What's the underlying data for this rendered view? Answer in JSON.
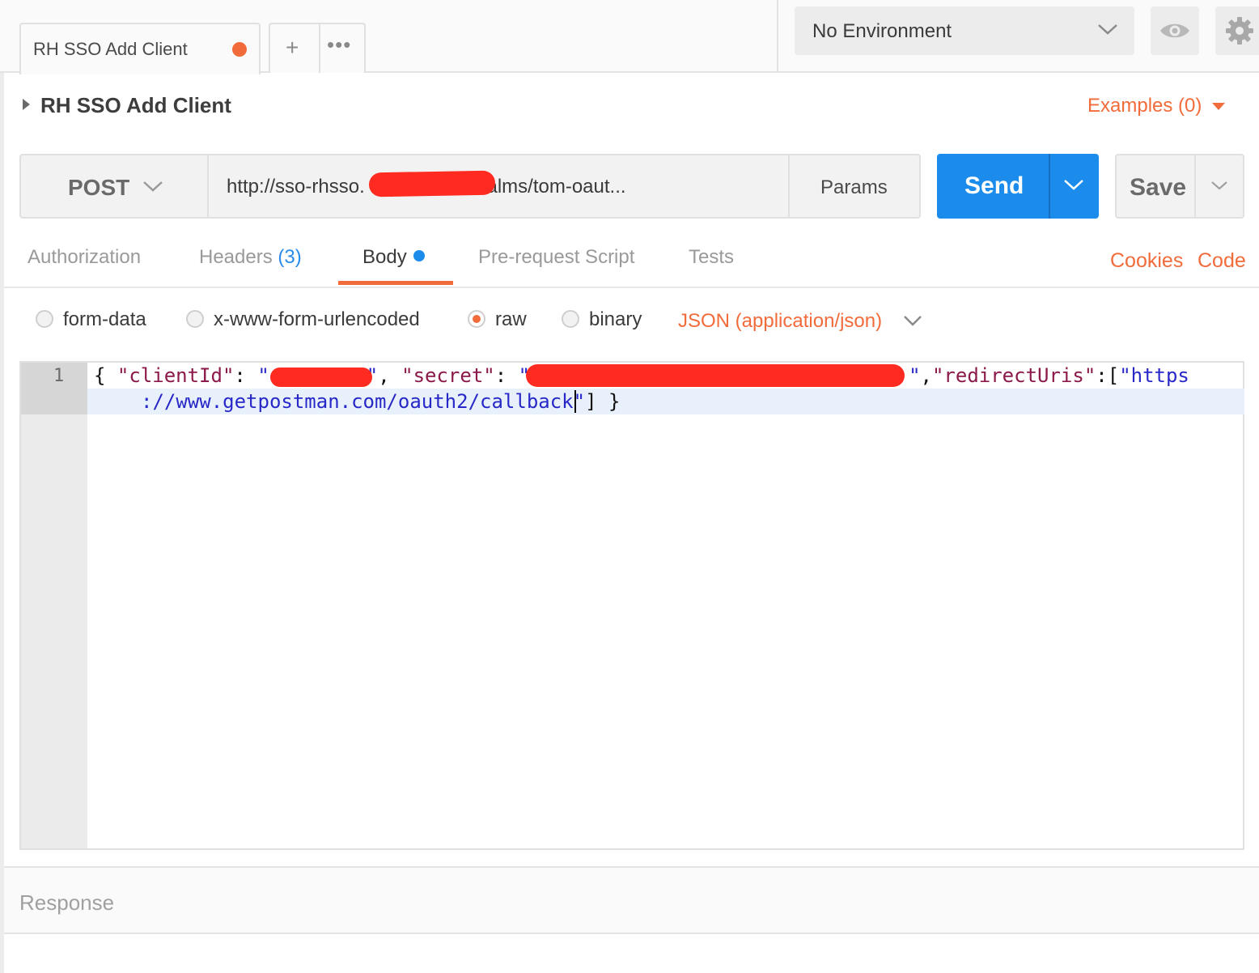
{
  "tabs": {
    "active_label": "RH SSO Add Client",
    "dot_color": "#f26b3a",
    "add_glyph": "+",
    "more_glyph": "•••"
  },
  "environment": {
    "selected": "No Environment",
    "quicklook_icon": "eye-icon",
    "settings_icon": "gear-icon"
  },
  "request": {
    "name": "RH SSO Add Client",
    "examples_label": "Examples (0)",
    "method": "POST",
    "url_visible": "http://sso-rhsso.                        .xip.io/auth/realms/tom-oaut...",
    "params_label": "Params",
    "send_label": "Send",
    "save_label": "Save"
  },
  "subtabs": {
    "authorization": "Authorization",
    "headers": "Headers",
    "headers_count": "(3)",
    "body": "Body",
    "prerequest": "Pre-request Script",
    "tests": "Tests",
    "cookies": "Cookies",
    "code": "Code"
  },
  "body_mode": {
    "form_data": "form-data",
    "urlencoded": "x-www-form-urlencoded",
    "raw": "raw",
    "binary": "binary",
    "selected": "raw",
    "content_type": "JSON (application/json)"
  },
  "editor": {
    "line_number": "1",
    "line1_open": "{ ",
    "key_client": "\"clientId\"",
    "colon1": ": ",
    "quote_a": "\"",
    "quote_b": "\"",
    "comma1": ", ",
    "key_secret": "\"secret\"",
    "colon2": ": ",
    "quote_c": "\"",
    "quote_d": "\"",
    "comma2": ",",
    "key_redirect": "\"redirectUris\"",
    "colon3": ":[",
    "url_part1": "\"https",
    "url_part2": "://www.getpostman.com/oauth2/callback\"",
    "line_close": "] }"
  },
  "response": {
    "label": "Response"
  },
  "colors": {
    "accent_orange": "#f26b3a",
    "send_blue": "#1c8cec",
    "redaction_red": "#ff2b20"
  }
}
